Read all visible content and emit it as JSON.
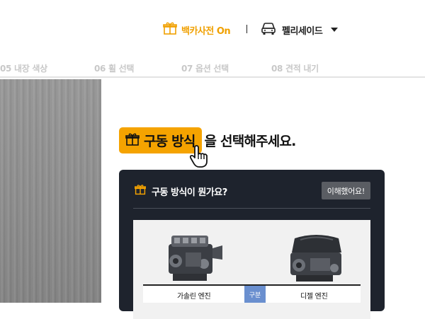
{
  "header": {
    "dictionary_label": "백카사전 On",
    "car_model": "펠리세이드"
  },
  "steps": [
    {
      "label": "05 내장 색상"
    },
    {
      "label": "06 휠 선택"
    },
    {
      "label": "07 옵션 선택"
    },
    {
      "label": "08 견적 내기"
    }
  ],
  "headline": {
    "highlight": "구동 방식",
    "rest": "을 선택해주세요."
  },
  "info_card": {
    "title": "구동 방식이 뭔가요?",
    "ok_button": "이해했어요!",
    "table": {
      "left": "가솔린 엔진",
      "middle": "구분",
      "right": "디젤 엔진"
    }
  },
  "colors": {
    "accent": "#f5a300",
    "card_bg": "#1e232d",
    "table_mid": "#6a8fcf"
  }
}
